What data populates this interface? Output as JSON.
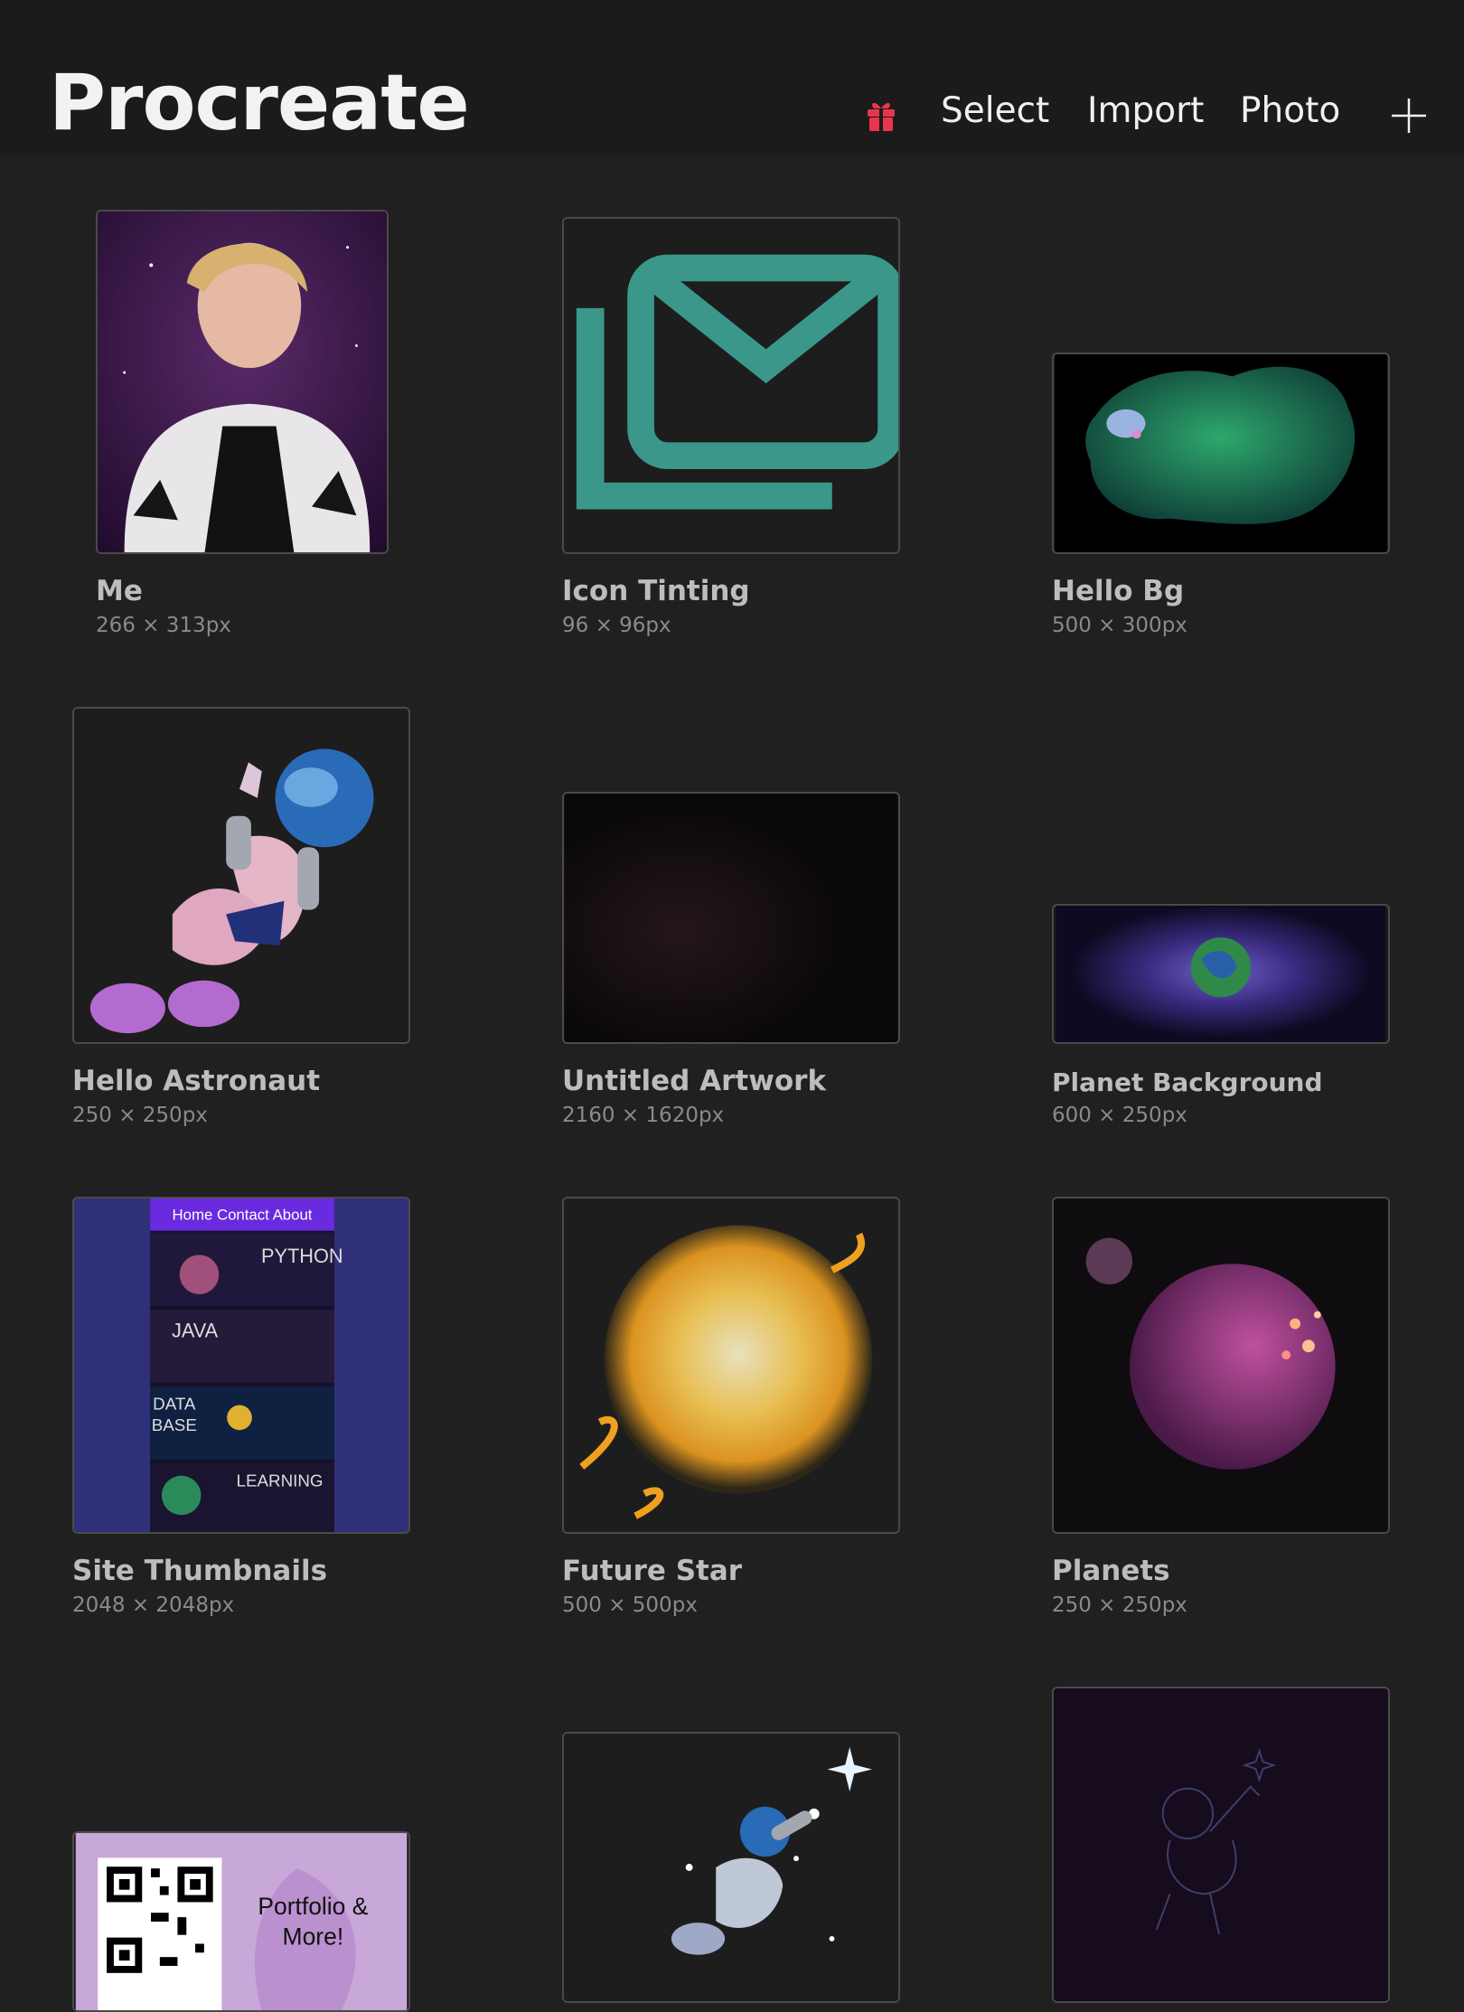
{
  "header": {
    "title": "Procreate",
    "select_label": "Select",
    "import_label": "Import",
    "photo_label": "Photo",
    "gift_color": "#e8364f",
    "gift_icon": "gift-icon",
    "plus_icon": "plus-icon"
  },
  "gallery": {
    "items": [
      {
        "name": "Me",
        "dims": "266 × 313px"
      },
      {
        "name": "Icon Tinting",
        "dims": "96 × 96px"
      },
      {
        "name": "Hello Bg",
        "dims": "500 × 300px"
      },
      {
        "name": "Hello Astronaut",
        "dims": "250 × 250px"
      },
      {
        "name": "Untitled Artwork",
        "dims": "2160 × 1620px"
      },
      {
        "name": "Planet Background",
        "dims": "600 × 250px"
      },
      {
        "name": "Site Thumbnails",
        "dims": "2048 × 2048px",
        "thumb_text": [
          "Home Contact About",
          "PYTHON",
          "JAVA",
          "DATA",
          "BASE",
          "LEARNING"
        ]
      },
      {
        "name": "Future Star",
        "dims": "500 × 500px"
      },
      {
        "name": "Planets",
        "dims": "250 × 250px"
      },
      {
        "thumb_text": [
          "Portfolio &",
          "More!"
        ]
      },
      {},
      {}
    ]
  }
}
